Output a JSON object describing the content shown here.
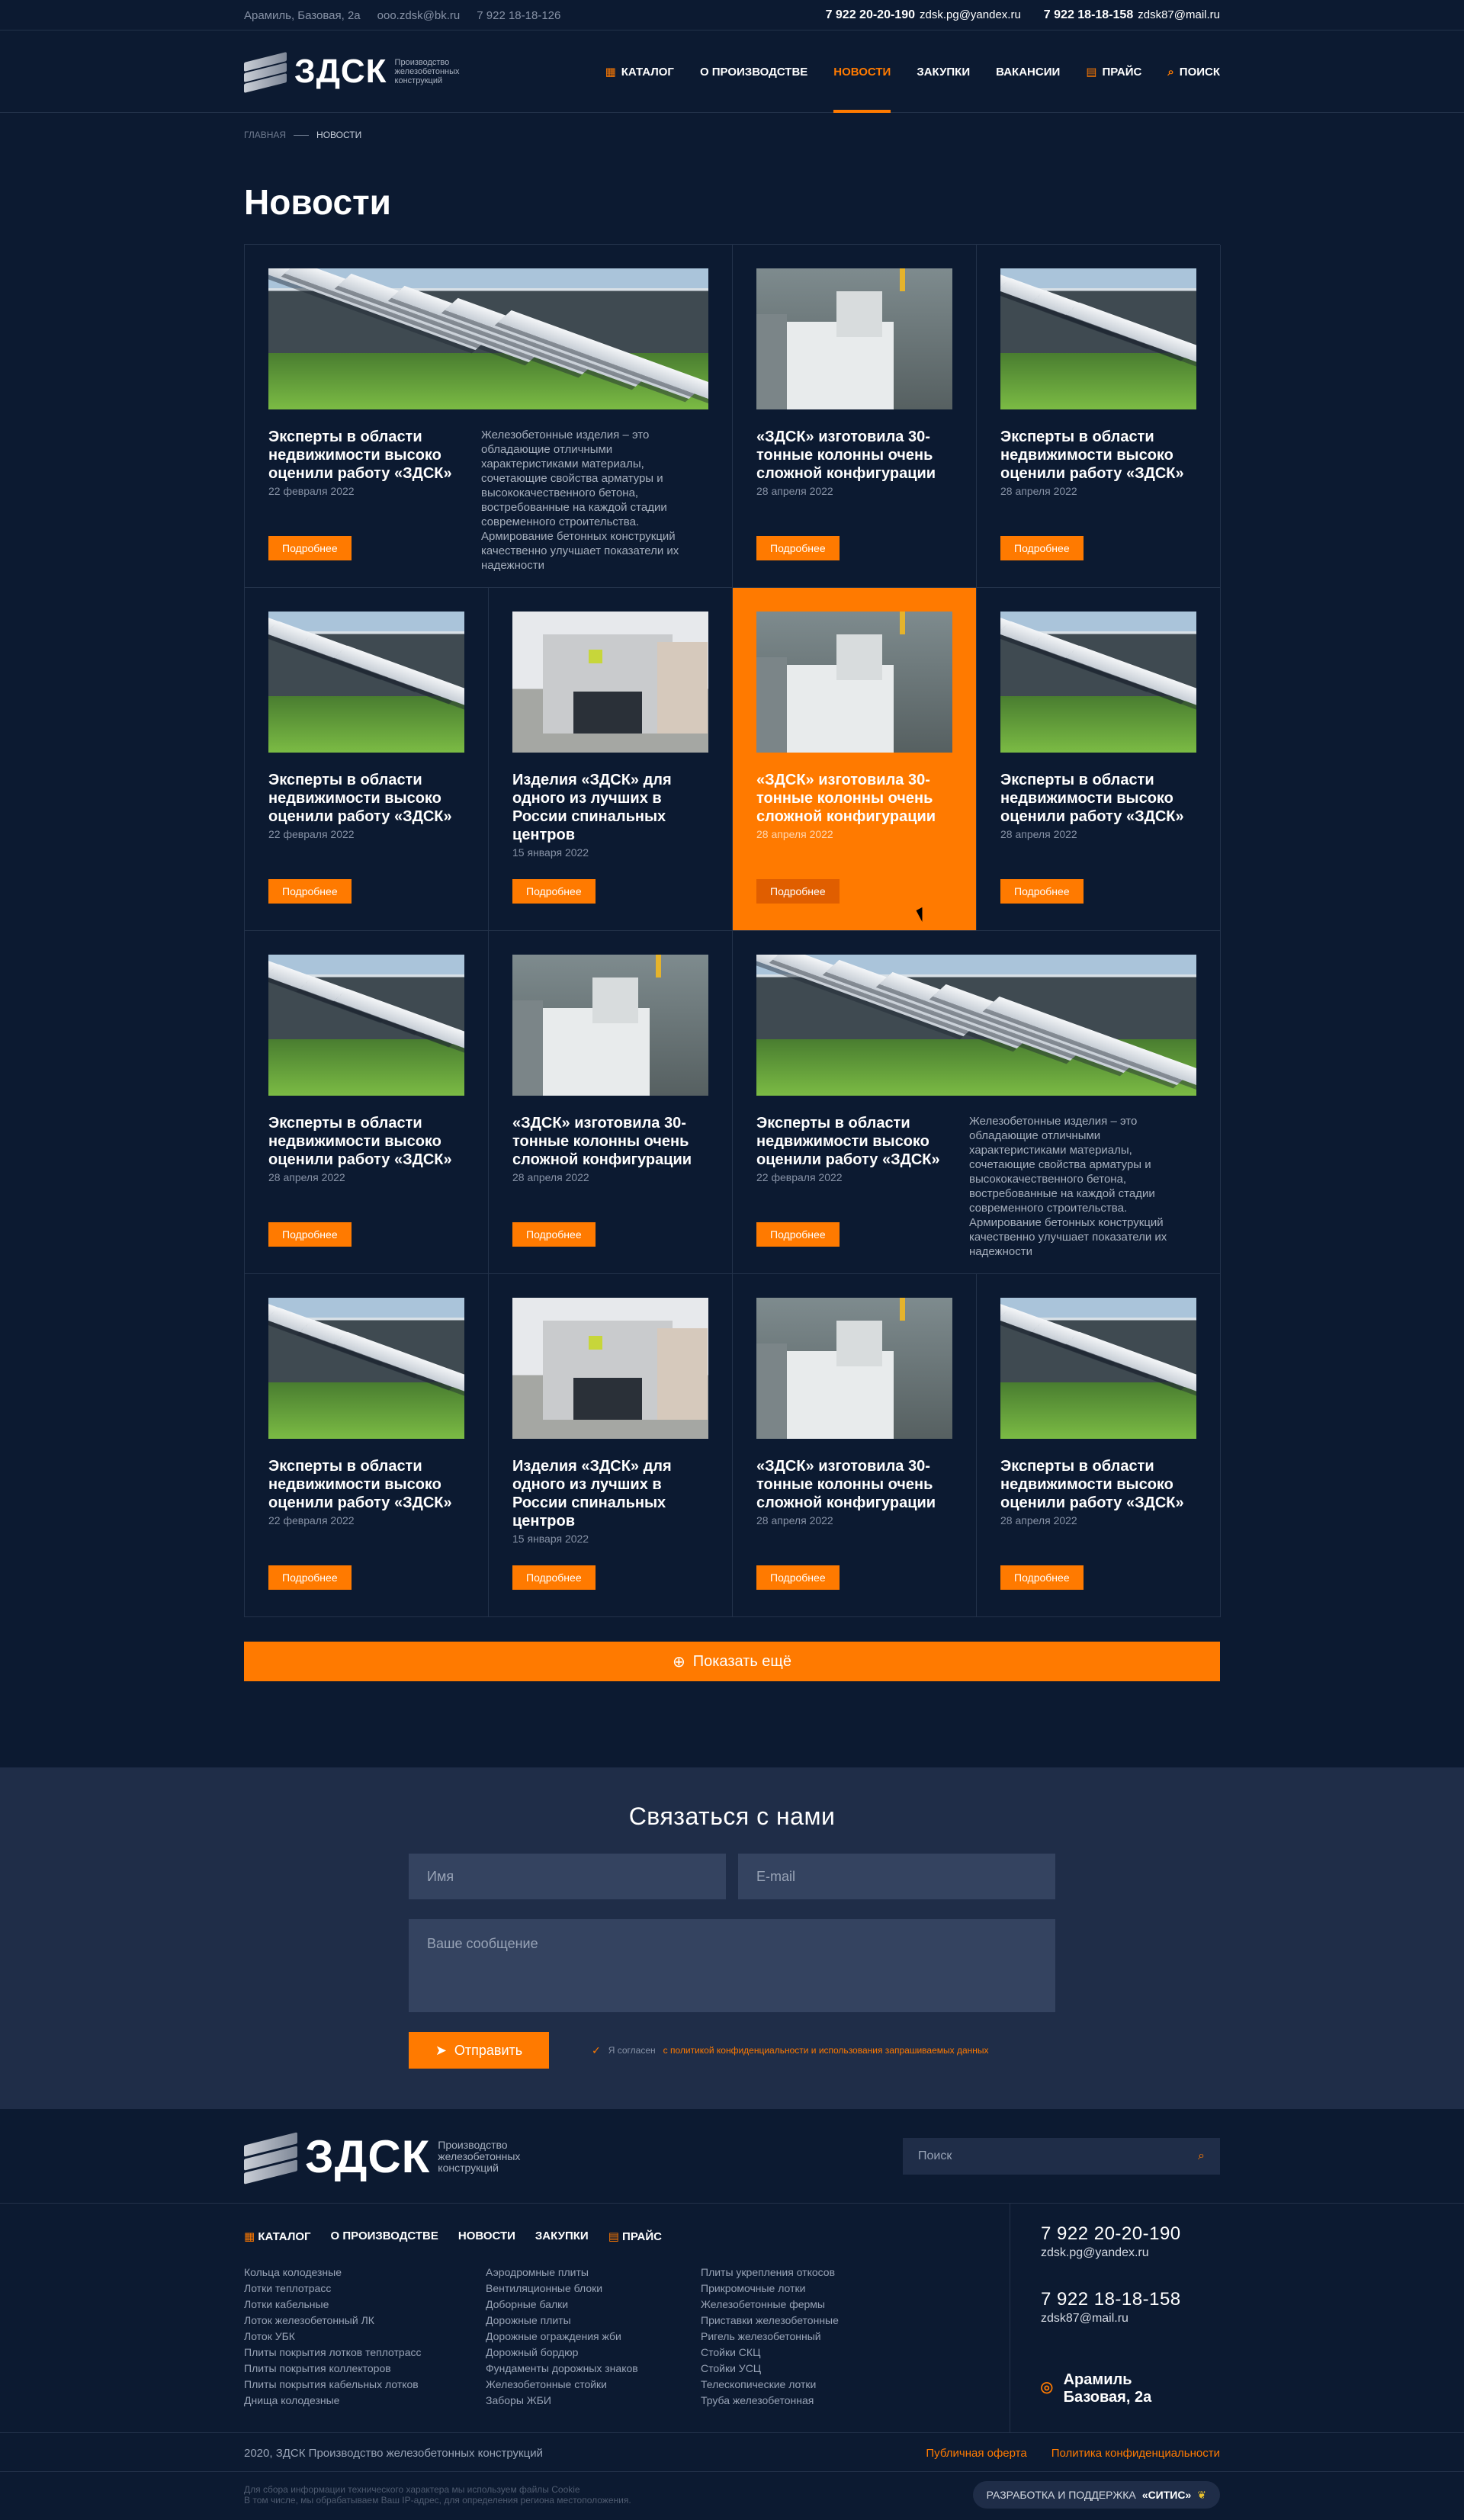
{
  "topbar": {
    "address": "Арамиль, Базовая, 2а",
    "email1": "ooo.zdsk@bk.ru",
    "phone_small": "7 922 18-18-126",
    "phone1": "7 922 20-20-190",
    "email2": "zdsk.pg@yandex.ru",
    "phone2": "7 922 18-18-158",
    "email3": "zdsk87@mail.ru"
  },
  "header": {
    "logo": "ЗДСК",
    "logo_sub": "Производство железобетонных конструкций",
    "nav": [
      "Каталог",
      "О производстве",
      "Новости",
      "Закупки",
      "Вакансии",
      "Прайс",
      "Поиск"
    ]
  },
  "breadcrumb": {
    "home": "Главная",
    "current": "Новости"
  },
  "page_title": "Новости",
  "more_label": "Подробнее",
  "load_more": "Показать ещё",
  "news": [
    {
      "title": "Эксперты в области недвижимости высоко оценили работу «ЗДСК»",
      "date": "22 февраля 2022",
      "img": "farm",
      "desc": "Железобетонные изделия – это обладающие отличными характеристиками материалы, сочетающие свойства арматуры и высококачественного бетона, востребованные на каждой стадии современного строительства. Армирование бетонных конструкций качественно улучшает показатели их надежности"
    },
    {
      "title": "«ЗДСК» изготовила 30-тонные колонны очень сложной конфигурации",
      "date": "28 апреля 2022",
      "img": "col"
    },
    {
      "title": "Эксперты в области недвижимости высоко оценили работу «ЗДСК»",
      "date": "28 апреля 2022",
      "img": "farm"
    },
    {
      "title": "Эксперты в области недвижимости высоко оценили работу «ЗДСК»",
      "date": "22 февраля 2022",
      "img": "farm"
    },
    {
      "title": "Изделия «ЗДСК» для одного из лучших в России спинальных центров",
      "date": "15 января 2022",
      "img": "bld"
    },
    {
      "title": "«ЗДСК» изготовила 30-тонные колонны очень сложной конфигурации",
      "date": "28 апреля 2022",
      "img": "col"
    },
    {
      "title": "Эксперты в области недвижимости высоко оценили работу «ЗДСК»",
      "date": "28 апреля 2022",
      "img": "farm"
    },
    {
      "title": "Эксперты в области недвижимости высоко оценили работу «ЗДСК»",
      "date": "28 апреля 2022",
      "img": "farm"
    },
    {
      "title": "«ЗДСК» изготовила 30-тонные колонны очень сложной конфигурации",
      "date": "28 апреля 2022",
      "img": "col"
    },
    {
      "title": "Эксперты в области недвижимости высоко оценили работу «ЗДСК»",
      "date": "22 февраля 2022",
      "img": "farm",
      "desc": "Железобетонные изделия – это обладающие отличными характеристиками материалы, сочетающие свойства арматуры и высококачественного бетона, востребованные на каждой стадии современного строительства. Армирование бетонных конструкций качественно улучшает показатели их надежности"
    },
    {
      "title": "Эксперты в области недвижимости высоко оценили работу «ЗДСК»",
      "date": "22 февраля 2022",
      "img": "farm"
    },
    {
      "title": "Изделия «ЗДСК» для одного из лучших в России спинальных центров",
      "date": "15 января 2022",
      "img": "bld"
    },
    {
      "title": "«ЗДСК» изготовила 30-тонные колонны очень сложной конфигурации",
      "date": "28 апреля 2022",
      "img": "col"
    },
    {
      "title": "Эксперты в области недвижимости высоко оценили работу «ЗДСК»",
      "date": "28 апреля 2022",
      "img": "farm"
    }
  ],
  "contact": {
    "title": "Связаться с нами",
    "name_ph": "Имя",
    "email_ph": "E-mail",
    "msg_ph": "Ваше сообщение",
    "send": "Отправить",
    "agree_text": "Я согласен",
    "agree_link": "с политикой конфиденциальности и использования запрашиваемых данных"
  },
  "footer": {
    "logo": "ЗДСК",
    "logo_sub": "Производство железобетонных конструкций",
    "search_ph": "Поиск",
    "nav": [
      "Каталог",
      "О производстве",
      "Новости",
      "Закупки",
      "Прайс"
    ],
    "col1": [
      "Кольца колодезные",
      "Лотки теплотрасс",
      "Лотки кабельные",
      "Лоток железобетонный ЛК",
      "Лоток УБК",
      "Плиты покрытия лотков теплотрасс",
      "Плиты покрытия коллекторов",
      "Плиты покрытия кабельных лотков",
      "Днища колодезные"
    ],
    "col2": [
      "Аэродромные плиты",
      "Вентиляционные блоки",
      "Доборные балки",
      "Дорожные плиты",
      "Дорожные ограждения жби",
      "Дорожный бордюр",
      "Фундаменты дорожных знаков",
      "Железобетонные стойки",
      "Заборы ЖБИ"
    ],
    "col3": [
      "Плиты укрепления откосов",
      "Прикромочные лотки",
      "Железобетонные фермы",
      "Приставки железобетонные",
      "Ригель железобетонный",
      "Стойки СКЦ",
      "Стойки УСЦ",
      "Телескопические лотки",
      "Труба железобетонная"
    ],
    "phone1": "7 922 20-20-190",
    "email1": "zdsk.pg@yandex.ru",
    "phone2": "7 922 18-18-158",
    "email2": "zdsk87@mail.ru",
    "address1": "Арамиль",
    "address2": "Базовая, 2а",
    "copyright": "2020, ЗДСК Производство железобетонных конструкций",
    "offer": "Публичная оферта",
    "privacy": "Политика конфиденциальности",
    "cookie1": "Для сбора информации технического характера мы используем файлы Cookie",
    "cookie2": "В том числе, мы обрабатываем Ваш IP-адрес, для определения региона местоположения.",
    "dev_label": "Разработка и поддержка",
    "dev_name": "«СИТИС»"
  }
}
